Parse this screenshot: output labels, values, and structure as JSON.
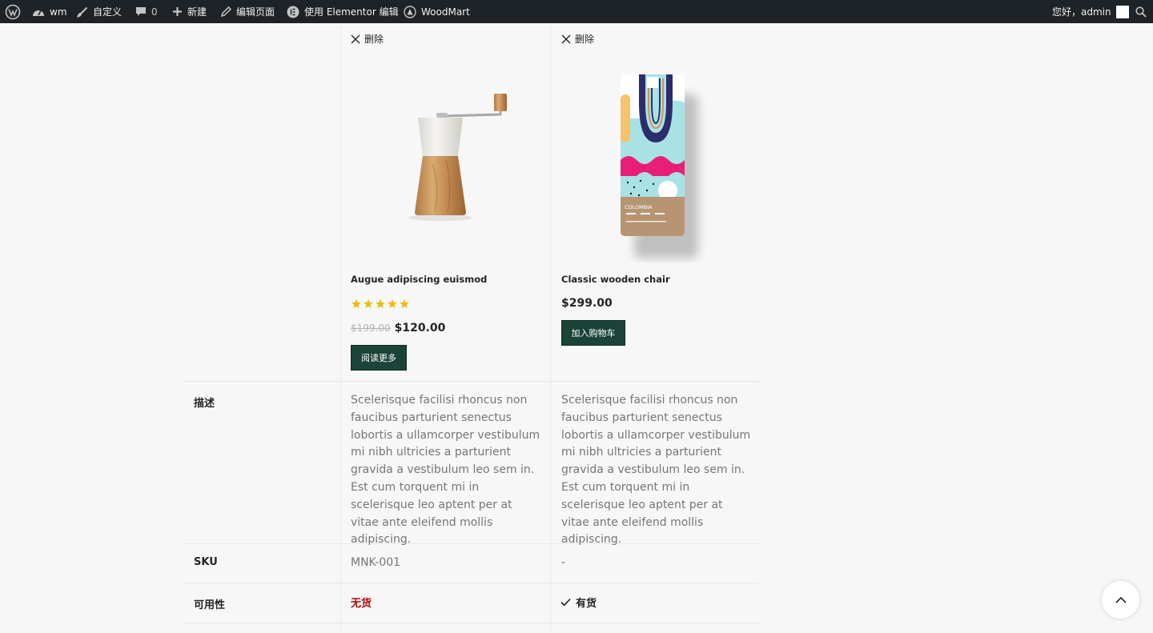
{
  "adminbar": {
    "site_name": "wm",
    "customize": "自定义",
    "comments_count": "0",
    "new": "新建",
    "edit_page": "编辑页面",
    "elementor": "使用 Elementor 编辑",
    "theme": "WoodMart",
    "greeting": "您好，admin"
  },
  "compare": {
    "remove_label": "删除",
    "products": [
      {
        "title": "Augue adipiscing euismod",
        "rating": 5,
        "old_price": "$199.00",
        "price": "$120.00",
        "button": "阅读更多",
        "description": "Scelerisque facilisi rhoncus non faucibus parturient senectus lobortis a ullamcorper vestibulum mi nibh ultricies a parturient gravida a vestibulum leo sem in. Est cum torquent mi in scelerisque leo aptent per at vitae ante eleifend mollis adipiscing.",
        "sku": "MNK-001",
        "availability": "无货"
      },
      {
        "title": "Classic wooden chair",
        "price": "$299.00",
        "button": "加入购物车",
        "description": "Scelerisque facilisi rhoncus non faucibus parturient senectus lobortis a ullamcorper vestibulum mi nibh ultricies a parturient gravida a vestibulum leo sem in. Est cum torquent mi in scelerisque leo aptent per at vitae ante eleifend mollis adipiscing.",
        "sku": "-",
        "availability": "有货",
        "package_label": "COLOMBIA"
      }
    ],
    "row_labels": {
      "description": "描述",
      "sku": "SKU",
      "availability": "可用性"
    }
  },
  "colors": {
    "button_bg": "#1b4338",
    "star": "#eabe12",
    "out_of_stock": "#b50808"
  }
}
